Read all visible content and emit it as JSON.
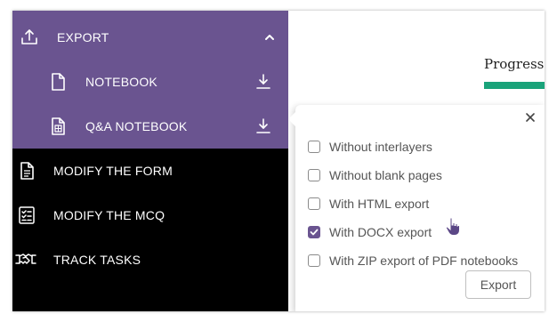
{
  "sidebar": {
    "items": [
      {
        "label": "EXPORT",
        "icon": "upload-icon",
        "expanded": true
      },
      {
        "label": "NOTEBOOK",
        "icon": "document-icon",
        "action_icon": "download-icon"
      },
      {
        "label": "Q&A NOTEBOOK",
        "icon": "qa-document-icon",
        "action_icon": "download-icon"
      },
      {
        "label": "MODIFY THE FORM",
        "icon": "form-icon"
      },
      {
        "label": "MODIFY THE MCQ",
        "icon": "checklist-icon"
      },
      {
        "label": "TRACK TASKS",
        "icon": "handshake-icon"
      }
    ],
    "accent_color": "#6a5490",
    "background_color": "#000000"
  },
  "main": {
    "progress_label": "Progress",
    "progress_color": "#1aa37a"
  },
  "export_popup": {
    "options": [
      {
        "label": "Without interlayers",
        "checked": false
      },
      {
        "label": "Without blank pages",
        "checked": false
      },
      {
        "label": "With HTML export",
        "checked": false
      },
      {
        "label": "With DOCX export",
        "checked": true
      },
      {
        "label": "With ZIP export of PDF notebooks",
        "checked": false
      }
    ],
    "export_button_label": "Export"
  }
}
